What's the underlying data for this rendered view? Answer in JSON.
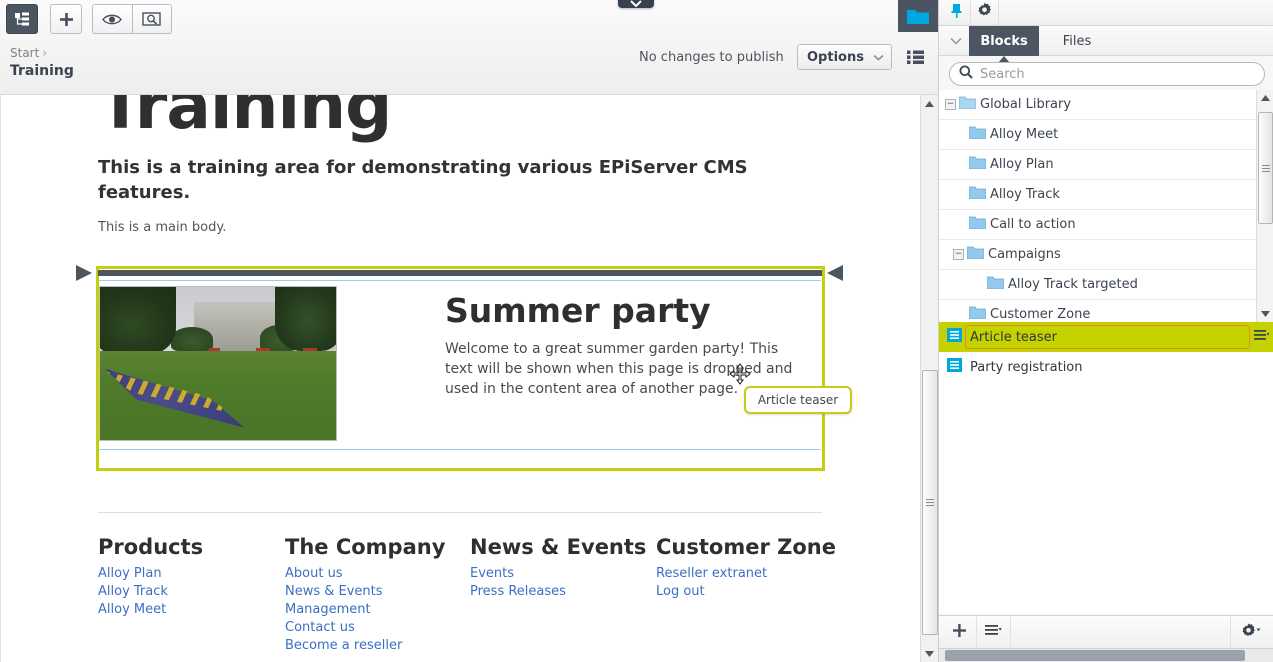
{
  "toolbar": {
    "nav_icon": "tree-structure-icon",
    "add_icon": "plus-icon",
    "preview_icon": "eye-icon",
    "inspect_icon": "preview-search-icon",
    "folder_icon": "folder-icon",
    "center_handle_icon": "chevron-down-icon",
    "publish_status": "No changes to publish",
    "options_label": "Options",
    "options_chevron_icon": "chevron-down-icon",
    "list_toggle_icon": "list-view-icon"
  },
  "breadcrumb": {
    "root": "Start",
    "separator": "›",
    "current": "Training"
  },
  "page": {
    "heading": "Training",
    "intro": "This is a training area for demonstrating various EPiServer CMS features.",
    "body": "This is a main body."
  },
  "teaser": {
    "title": "Summer party",
    "text": "Welcome to a great summer garden party! This text will be shown when this page is dropped and used in the content area of another page.",
    "image_alt": "garden-photo",
    "tooltip": "Article teaser",
    "cursor_icon": "move-cursor-icon"
  },
  "footer": {
    "columns": [
      {
        "title": "Products",
        "links": [
          "Alloy Plan",
          "Alloy Track",
          "Alloy Meet"
        ]
      },
      {
        "title": "The Company",
        "links": [
          "About us",
          "News & Events",
          "Management",
          "Contact us",
          "Become a reseller"
        ]
      },
      {
        "title": "News & Events",
        "links": [
          "Events",
          "Press Releases"
        ]
      },
      {
        "title": "Customer Zone",
        "links": [
          "Reseller extranet",
          "Log out"
        ]
      }
    ]
  },
  "right_panel": {
    "pin_icon": "pin-icon",
    "gear_icon": "gear-icon",
    "collapse_icon": "chevron-down-icon",
    "tabs": [
      {
        "label": "Blocks",
        "active": true
      },
      {
        "label": "Files",
        "active": false
      }
    ],
    "search": {
      "icon": "search-icon",
      "placeholder": "Search",
      "value": ""
    },
    "tree": [
      {
        "label": "Global Library",
        "indent": 0,
        "expander": "−",
        "icon": "library-folder-icon"
      },
      {
        "label": "Alloy Meet",
        "indent": 1,
        "expander": "",
        "icon": "folder-icon"
      },
      {
        "label": "Alloy Plan",
        "indent": 1,
        "expander": "",
        "icon": "folder-icon"
      },
      {
        "label": "Alloy Track",
        "indent": 1,
        "expander": "",
        "icon": "folder-icon"
      },
      {
        "label": "Call to action",
        "indent": 1,
        "expander": "",
        "icon": "folder-icon"
      },
      {
        "label": "Campaigns",
        "indent": 1,
        "expander": "−",
        "icon": "folder-icon"
      },
      {
        "label": "Alloy Track targeted",
        "indent": 2,
        "expander": "",
        "icon": "folder-icon"
      },
      {
        "label": "Customer Zone",
        "indent": 1,
        "expander": "",
        "icon": "folder-icon"
      }
    ],
    "blocks": [
      {
        "label": "Article teaser",
        "selected": true,
        "icon": "block-icon",
        "menu_icon": "row-menu-icon"
      },
      {
        "label": "Party registration",
        "selected": false,
        "icon": "block-icon",
        "menu_icon": ""
      }
    ],
    "bottom_toolbar": {
      "add_icon": "plus-icon",
      "menu_icon": "list-menu-icon",
      "settings_icon": "gear-dropdown-icon"
    }
  },
  "colors": {
    "accent_highlight": "#c6d100",
    "selection_border": "#d9921a",
    "dark_chrome": "#4b5662",
    "link": "#3a6fc4",
    "block_icon": "#00a8e0",
    "drop_bar": "#4c5661"
  }
}
